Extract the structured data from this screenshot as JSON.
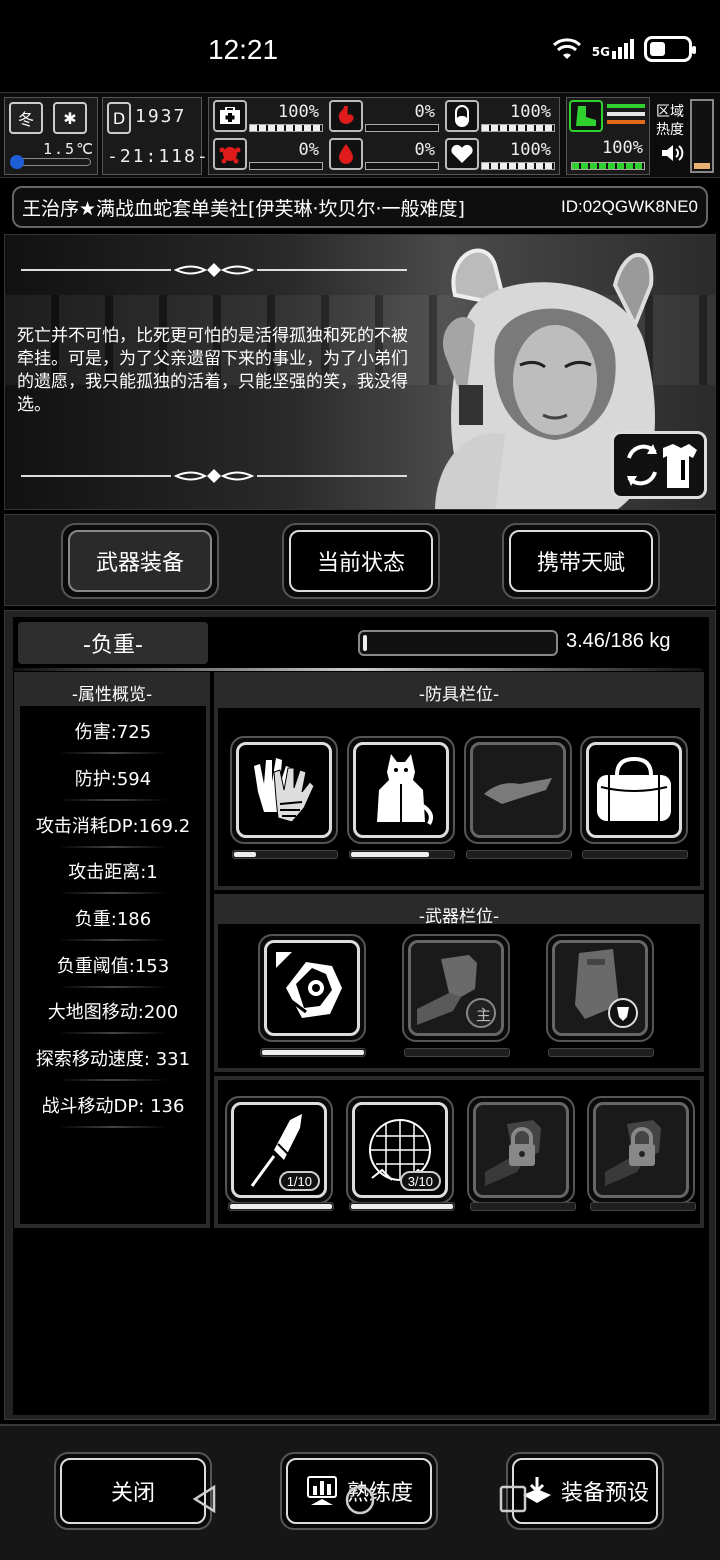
{
  "statusbar": {
    "time": "12:21",
    "network": "5G",
    "battery_level": 0.42
  },
  "hud": {
    "season": "冬",
    "temperature": "1.5℃",
    "day_counter": "1937",
    "clock": "-21:118-",
    "health_pct": "100%",
    "hunger_pct": "0%",
    "infection_pct": "0%",
    "bleeding_pct": "0%",
    "stamina_pct": "100%",
    "mood_pct": "100%",
    "area_pct": "100%",
    "area_label_1": "区域",
    "area_label_2": "热度"
  },
  "title": {
    "text": "王治序★满战血蛇套单美社[伊芙琳·坎贝尔·一般难度]",
    "id": "ID:02QGWK8NE0"
  },
  "banner": {
    "quote": "死亡并不可怕，比死更可怕的是活得孤独和死的不被牵挂。可是，为了父亲遗留下来的事业，为了小弟们的遗愿，我只能孤独的活着，只能坚强的笑，我没得选。"
  },
  "tabs": [
    {
      "label": "武器装备",
      "active": true
    },
    {
      "label": "当前状态",
      "active": false
    },
    {
      "label": "携带天赋",
      "active": false
    }
  ],
  "load": {
    "label": "-负重-",
    "text": "3.46/186 kg",
    "fraction": 0.019
  },
  "attributes": {
    "header": "-属性概览-",
    "items": [
      "伤害:725",
      "防护:594",
      "攻击消耗DP:169.2",
      "攻击距离:1",
      "负重:186",
      "负重阈值:153",
      "大地图移动:200",
      "探索移动速度: 331",
      "战斗移动DP: 136"
    ]
  },
  "armor": {
    "header": "-防具栏位-",
    "slots": [
      {
        "icon": "gloves-icon",
        "durability": 0.22
      },
      {
        "icon": "hooded-coat-icon",
        "durability": 0.76
      },
      {
        "icon": "cap-icon",
        "durability": 0.0
      },
      {
        "icon": "duffel-bag-icon",
        "durability": 0.0
      }
    ]
  },
  "weapons": {
    "header": "-武器栏位-",
    "slots": [
      {
        "icon": "wrapped-fist-icon",
        "durability": 1.0
      },
      {
        "icon": "fist-main-icon",
        "durability": 0.0,
        "badge": "主"
      },
      {
        "icon": "riot-shield-icon",
        "durability": 0.0
      }
    ]
  },
  "consumables": {
    "slots": [
      {
        "icon": "firework-rocket-icon",
        "count": "1/10",
        "durability": 1.0
      },
      {
        "icon": "net-trap-icon",
        "count": "3/10",
        "durability": 1.0
      },
      {
        "icon": "locked-slot-icon",
        "durability": 0.0
      },
      {
        "icon": "locked-slot-icon",
        "durability": 0.0
      }
    ]
  },
  "bottom": {
    "close": "关闭",
    "proficiency": "熟练度",
    "preset": "装备预设"
  }
}
